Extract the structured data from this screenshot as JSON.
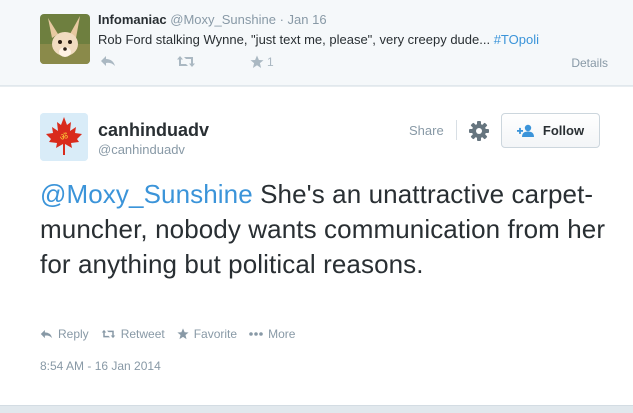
{
  "parent_tweet": {
    "name": "Infomaniac",
    "handle": "@Moxy_Sunshine",
    "date": "Jan 16",
    "text": "Rob Ford stalking Wynne, \"just text me, please\", very creepy dude...",
    "hashtag": "#TOpoli",
    "favorite_count": "1",
    "details_label": "Details"
  },
  "tweet": {
    "name": "canhinduadv",
    "handle": "@canhinduadv",
    "share_label": "Share",
    "follow_label": "Follow",
    "mention": "@Moxy_Sunshine",
    "text": " She's an unattractive carpet-muncher, nobody wants communication from her for anything but political reasons.",
    "actions": {
      "reply": "Reply",
      "retweet": "Retweet",
      "favorite": "Favorite",
      "more": "More"
    },
    "timestamp": "8:54 AM - 16 Jan 2014"
  },
  "colors": {
    "link": "#3b94d9",
    "avatar_maple": "#d92b1c"
  }
}
